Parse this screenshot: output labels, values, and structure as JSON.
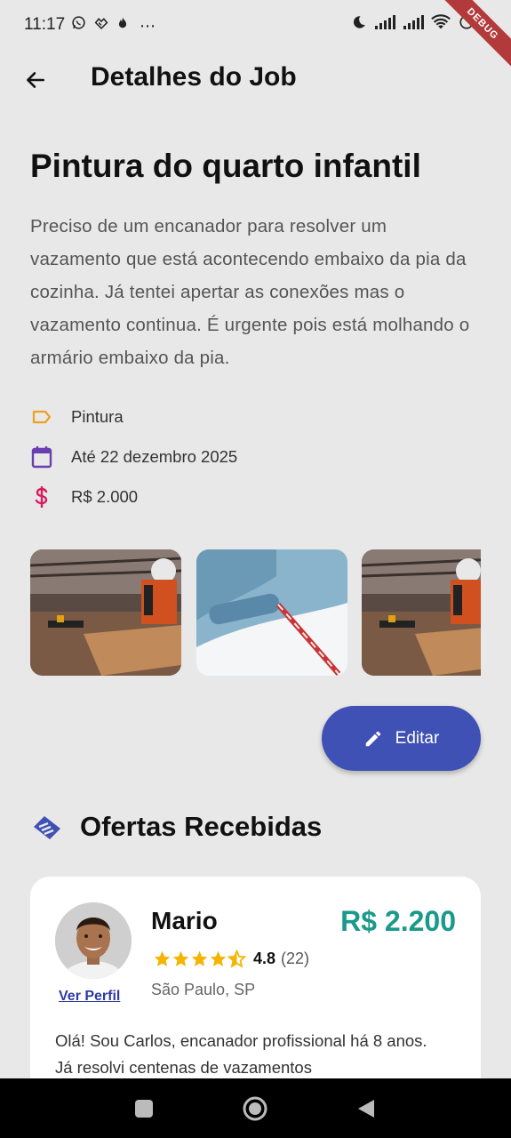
{
  "status_bar": {
    "time": "11:17",
    "left_icons": [
      "whatsapp-icon",
      "hands-icon",
      "flame-icon",
      "more-icon"
    ],
    "more": "⋯",
    "debug_label": "DEBUG"
  },
  "app_bar": {
    "title": "Detalhes do Job"
  },
  "job": {
    "title": "Pintura do quarto infantil",
    "description": "Preciso de um encanador para resolver um vazamento que está acontecendo embaixo da pia da cozinha. Já tentei apertar as conexões mas o vazamento continua. É urgente pois está molhando o armário embaixo da pia.",
    "category": "Pintura",
    "deadline": "Até 22 dezembro 2025",
    "budget": "R$ 2.000",
    "colors": {
      "category_icon": "#f0a020",
      "deadline_icon": "#6a3db0",
      "budget_icon": "#d81b60"
    }
  },
  "actions": {
    "edit_label": "Editar"
  },
  "offers": {
    "title": "Ofertas Recebidas",
    "items": [
      {
        "name": "Mario",
        "price": "R$ 2.200",
        "rating": "4.8",
        "count": "(22)",
        "stars": 4.5,
        "location": "São Paulo, SP",
        "profile_link": "Ver Perfil",
        "message": "Olá! Sou Carlos, encanador profissional há 8 anos. Já resolvi centenas de vazamentos"
      }
    ]
  },
  "theme": {
    "accent": "#3f51b5",
    "price_color": "#1a9a8a",
    "star_color": "#f4b400"
  }
}
